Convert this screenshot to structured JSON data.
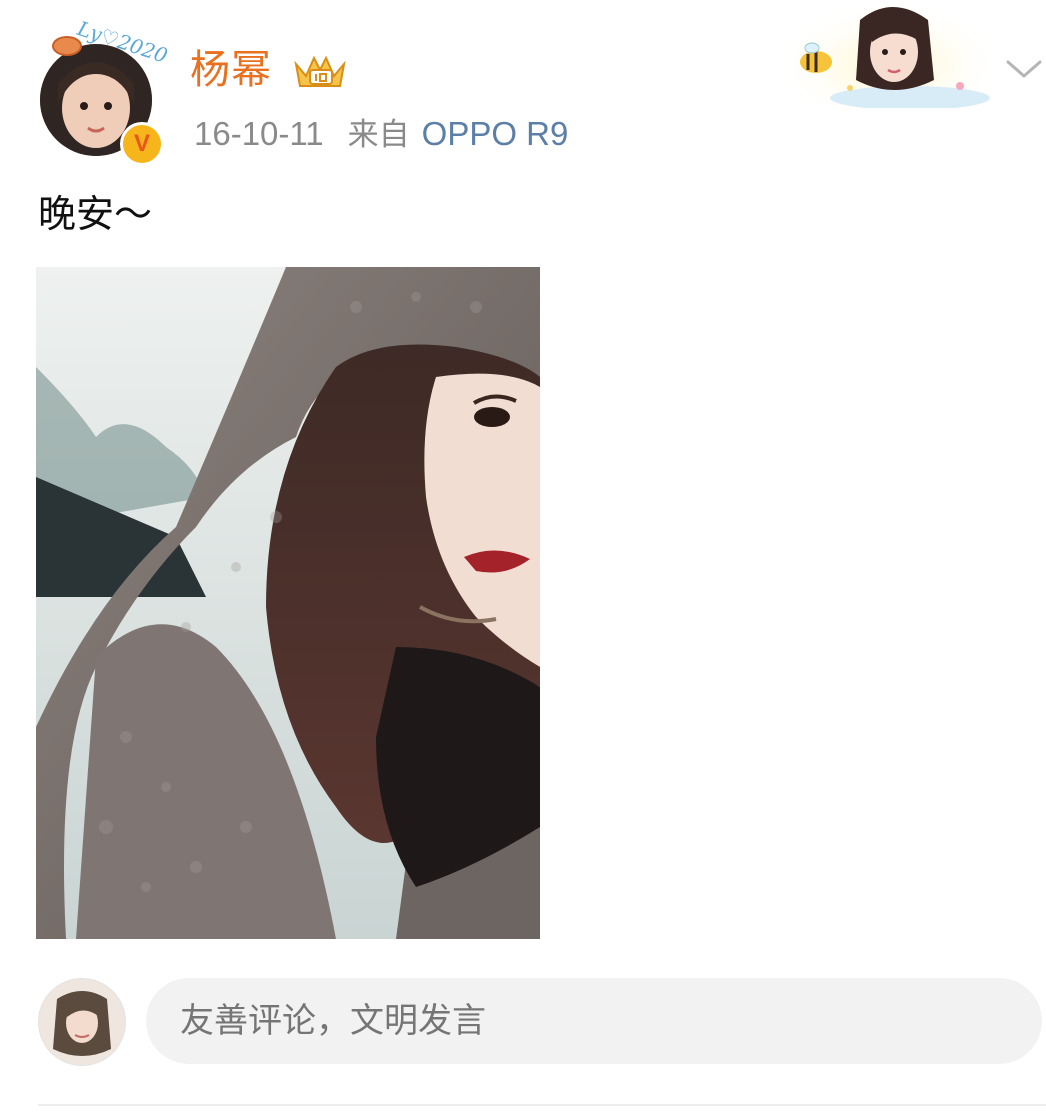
{
  "post": {
    "author": {
      "name": "杨幂",
      "avatar_frame_text": "Ly♡2020",
      "verified_mark": "V",
      "vip_icon": "vip-crown-icon"
    },
    "meta": {
      "date": "16-10-11",
      "source_prefix": "来自",
      "source_device": "OPPO R9"
    },
    "text": "晚安～",
    "photo": {
      "icon": "selfie-photo"
    }
  },
  "comment_bar": {
    "placeholder": "友善评论，文明发言"
  },
  "colors": {
    "username": "#e8701f",
    "device_link": "#5b7fa6",
    "meta_gray": "#8a8a8a",
    "input_bg": "#f2f2f2",
    "verified_badge": "#f7b51c"
  }
}
